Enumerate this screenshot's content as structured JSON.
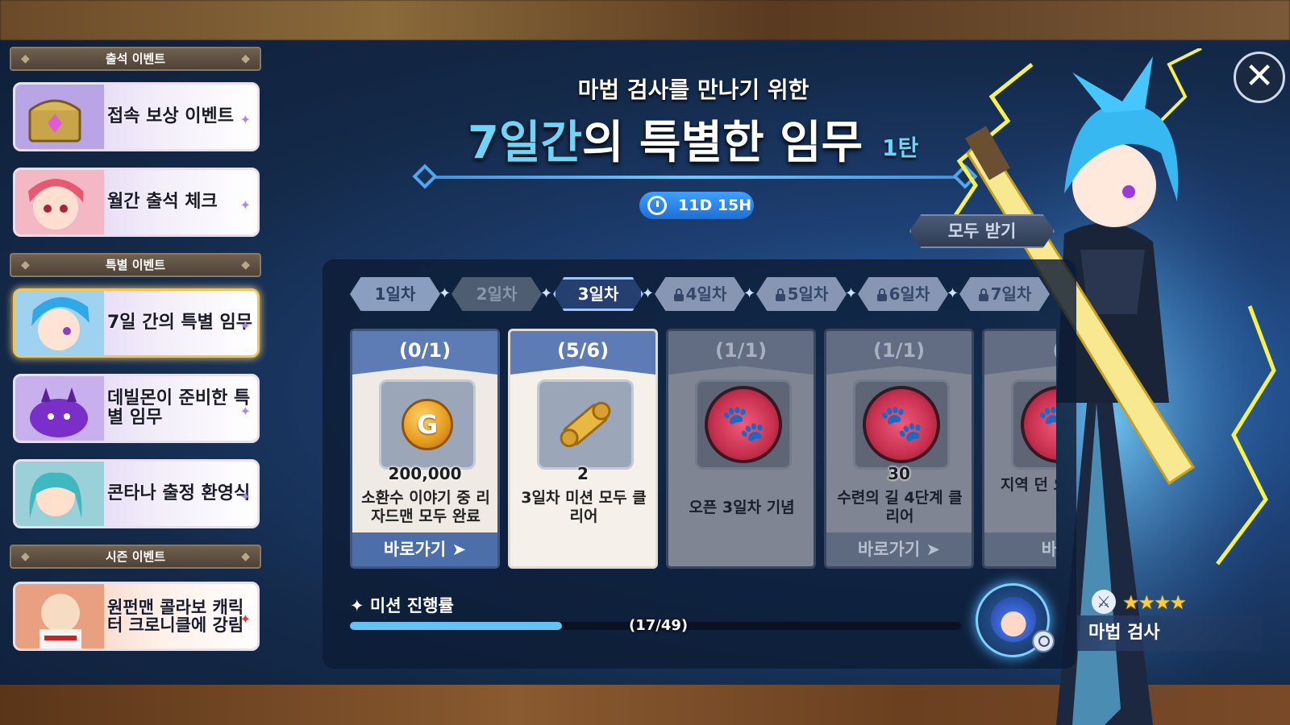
{
  "sidebar": {
    "sections": [
      {
        "header": "출석 이벤트"
      },
      {
        "header": "특별 이벤트"
      },
      {
        "header": "시즌 이벤트"
      }
    ],
    "items": [
      {
        "label": "접속 보상 이벤트"
      },
      {
        "label": "월간 출석 체크"
      },
      {
        "label": "7일 간의 특별 임무"
      },
      {
        "label": "데빌몬이 준비한 특별 임무"
      },
      {
        "label": "콘타나 출정 환영식"
      },
      {
        "label": "원펀맨 콜라보 캐릭터 크로니클에 강림"
      }
    ]
  },
  "header": {
    "subtitle": "마법 검사를 만나기 위한",
    "title_highlight": "7일간",
    "title_rest": "의 특별한 임무",
    "title_tag": "1탄",
    "timer": "11D 15H"
  },
  "receive_all_label": "모두 받기",
  "tabs": [
    "1일차",
    "2일차",
    "3일차",
    "4일차",
    "5일차",
    "6일차",
    "7일차"
  ],
  "cards": [
    {
      "progress": "(0/1)",
      "qty": "200,000",
      "desc": "소환수 이야기 중 리자드맨 모두 완료",
      "go": "바로가기",
      "icon": "gold-coin-icon"
    },
    {
      "progress": "(5/6)",
      "qty": "2",
      "desc": "3일차 미션 모두 클리어",
      "go": "",
      "icon": "scroll-icon"
    },
    {
      "progress": "(1/1)",
      "qty": "",
      "desc": "오픈 3일차 기념",
      "go": "",
      "icon": "paw-token-icon"
    },
    {
      "progress": "(1/1)",
      "qty": "30",
      "desc": "수련의 길 4단계 클리어",
      "go": "바로가기",
      "icon": "paw-token-icon"
    },
    {
      "progress": "(",
      "qty": "",
      "desc": "지역 던 오아시 로",
      "go": "바로",
      "icon": "paw-token-icon"
    }
  ],
  "progress": {
    "label": "미션 진행률",
    "count": "(17/49)",
    "value": 0.347
  },
  "character": {
    "name": "마법 검사",
    "stars": 4
  },
  "colors": {
    "accent": "#6fd4f5",
    "active_tab": "#243f70",
    "progress_fill": "#62c4f2"
  }
}
